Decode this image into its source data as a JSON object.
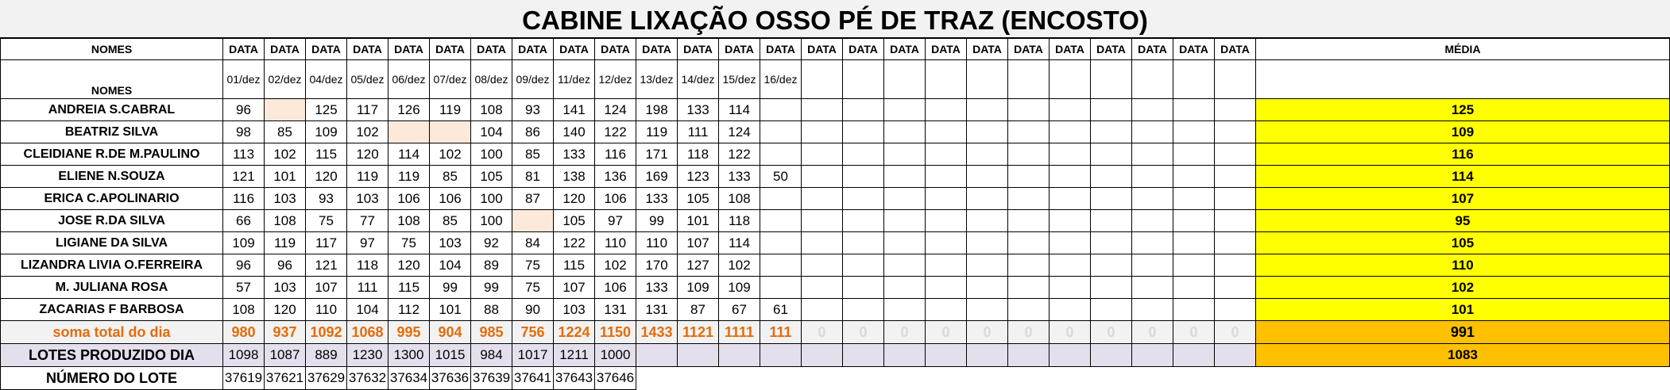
{
  "title": "CABINE LIXAÇÃO OSSO PÉ DE TRAZ (ENCOSTO)",
  "header": {
    "names_label": "NOMES",
    "date_label": "DATA",
    "media_label": "MÉDIA",
    "dates": [
      "01/dez",
      "02/dez",
      "04/dez",
      "05/dez",
      "06/dez",
      "07/dez",
      "08/dez",
      "09/dez",
      "11/dez",
      "12/dez",
      "13/dez",
      "14/dez",
      "15/dez",
      "16/dez",
      "",
      "",
      "",
      "",
      "",
      "",
      "",
      "",
      "",
      "",
      ""
    ]
  },
  "rows": [
    {
      "name": "ANDREIA S.CABRAL",
      "values": [
        "96",
        "",
        "125",
        "117",
        "126",
        "119",
        "108",
        "93",
        "141",
        "124",
        "198",
        "133",
        "114",
        "",
        "",
        "",
        "",
        "",
        "",
        "",
        "",
        "",
        "",
        "",
        ""
      ],
      "media": "125"
    },
    {
      "name": "BEATRIZ SILVA",
      "values": [
        "98",
        "85",
        "109",
        "102",
        "",
        "",
        "104",
        "86",
        "140",
        "122",
        "119",
        "111",
        "124",
        "",
        "",
        "",
        "",
        "",
        "",
        "",
        "",
        "",
        "",
        "",
        ""
      ],
      "media": "109"
    },
    {
      "name": "CLEIDIANE R.DE M.PAULINO",
      "values": [
        "113",
        "102",
        "115",
        "120",
        "114",
        "102",
        "100",
        "85",
        "133",
        "116",
        "171",
        "118",
        "122",
        "",
        "",
        "",
        "",
        "",
        "",
        "",
        "",
        "",
        "",
        "",
        ""
      ],
      "media": "116"
    },
    {
      "name": "ELIENE N.SOUZA",
      "values": [
        "121",
        "101",
        "120",
        "119",
        "119",
        "85",
        "105",
        "81",
        "138",
        "136",
        "169",
        "123",
        "133",
        "50",
        "",
        "",
        "",
        "",
        "",
        "",
        "",
        "",
        "",
        "",
        ""
      ],
      "media": "114"
    },
    {
      "name": "ERICA C.APOLINARIO",
      "values": [
        "116",
        "103",
        "93",
        "103",
        "106",
        "106",
        "100",
        "87",
        "120",
        "106",
        "133",
        "105",
        "108",
        "",
        "",
        "",
        "",
        "",
        "",
        "",
        "",
        "",
        "",
        "",
        ""
      ],
      "media": "107"
    },
    {
      "name": "JOSE R.DA SILVA",
      "values": [
        "66",
        "108",
        "75",
        "77",
        "108",
        "85",
        "100",
        "",
        "105",
        "97",
        "99",
        "101",
        "118",
        "",
        "",
        "",
        "",
        "",
        "",
        "",
        "",
        "",
        "",
        "",
        ""
      ],
      "media": "95"
    },
    {
      "name": "LIGIANE DA SILVA",
      "values": [
        "109",
        "119",
        "117",
        "97",
        "75",
        "103",
        "92",
        "84",
        "122",
        "110",
        "110",
        "107",
        "114",
        "",
        "",
        "",
        "",
        "",
        "",
        "",
        "",
        "",
        "",
        "",
        ""
      ],
      "media": "105"
    },
    {
      "name": "LIZANDRA LIVIA O.FERREIRA",
      "values": [
        "96",
        "96",
        "121",
        "118",
        "120",
        "104",
        "89",
        "75",
        "115",
        "102",
        "170",
        "127",
        "102",
        "",
        "",
        "",
        "",
        "",
        "",
        "",
        "",
        "",
        "",
        "",
        ""
      ],
      "media": "110"
    },
    {
      "name": "M. JULIANA ROSA",
      "values": [
        "57",
        "103",
        "107",
        "111",
        "115",
        "99",
        "99",
        "75",
        "107",
        "106",
        "133",
        "109",
        "109",
        "",
        "",
        "",
        "",
        "",
        "",
        "",
        "",
        "",
        "",
        "",
        ""
      ],
      "media": "102"
    },
    {
      "name": "ZACARIAS F BARBOSA",
      "values": [
        "108",
        "120",
        "110",
        "104",
        "112",
        "101",
        "88",
        "90",
        "103",
        "131",
        "131",
        "87",
        "67",
        "61",
        "",
        "",
        "",
        "",
        "",
        "",
        "",
        "",
        "",
        "",
        ""
      ],
      "media": "101"
    }
  ],
  "soma": {
    "label": "soma total  do dia",
    "values": [
      "980",
      "937",
      "1092",
      "1068",
      "995",
      "904",
      "985",
      "756",
      "1224",
      "1150",
      "1433",
      "1121",
      "1111",
      "111",
      "0",
      "0",
      "0",
      "0",
      "0",
      "0",
      "0",
      "0",
      "0",
      "0",
      "0"
    ],
    "media": "991"
  },
  "lotes": {
    "label": "LOTES PRODUZIDO DIA",
    "values": [
      "1098",
      "1087",
      "889",
      "1230",
      "1300",
      "1015",
      "984",
      "1017",
      "1211",
      "1000",
      "",
      "",
      "",
      "",
      "",
      "",
      "",
      "",
      "",
      "",
      "",
      "",
      "",
      "",
      ""
    ],
    "media": "1083"
  },
  "numero": {
    "label": "NÚMERO DO LOTE",
    "values": [
      "37619",
      "37621",
      "37629",
      "37632",
      "37634",
      "37636",
      "37639",
      "37641",
      "37643",
      "37646"
    ]
  },
  "colors": {
    "media_highlight": "#ffff00",
    "total_highlight": "#ffc000",
    "soma_text": "#e46c0a",
    "lotes_bg": "#e4dfec",
    "peach_blank": "#fde9d9"
  }
}
